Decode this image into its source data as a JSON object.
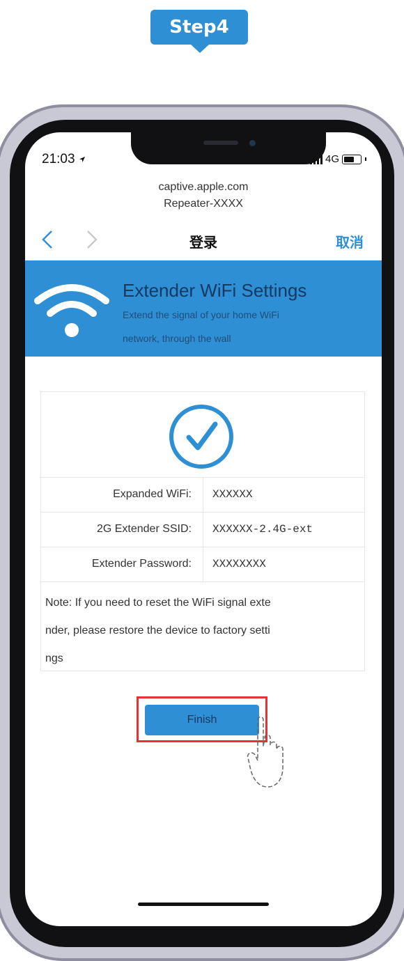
{
  "step": {
    "label": "Step4"
  },
  "status_bar": {
    "time": "21:03",
    "network": "4G"
  },
  "header": {
    "url": "captive.apple.com",
    "network_name": "Repeater-XXXX",
    "title": "登录",
    "cancel_label": "取消"
  },
  "banner": {
    "title": "Extender WiFi Settings",
    "subtitle_line1": "Extend the signal of your home WiFi",
    "subtitle_line2": "network, through the wall"
  },
  "details": {
    "rows": [
      {
        "label": "Expanded WiFi:",
        "value": "XXXXXX"
      },
      {
        "label": "2G Extender SSID:",
        "value": "XXXXXX-2.4G-ext"
      },
      {
        "label": "Extender Password:",
        "value": "XXXXXXXX"
      }
    ],
    "note_lines": [
      "Note: If you need to reset the WiFi signal exte",
      "nder, please restore the device to factory setti",
      "ngs"
    ]
  },
  "finish_label": "Finish",
  "colors": {
    "accent": "#2f8fd4",
    "highlight": "#e53333"
  },
  "icons": [
    "wifi-icon",
    "checkmark-circle-icon",
    "back-chevron-icon",
    "forward-chevron-icon",
    "hand-pointer-icon",
    "signal-icon",
    "battery-icon",
    "location-arrow-icon"
  ]
}
